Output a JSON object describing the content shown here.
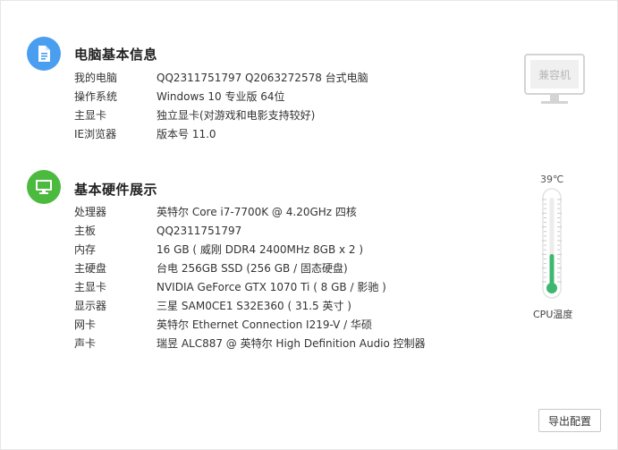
{
  "basic_info": {
    "title": "电脑基本信息",
    "rows": [
      {
        "label": "我的电脑",
        "value": "QQ2311751797 Q2063272578 台式电脑"
      },
      {
        "label": "操作系统",
        "value": "Windows 10 专业版 64位"
      },
      {
        "label": "主显卡",
        "value": "独立显卡(对游戏和电影支持较好)"
      },
      {
        "label": "IE浏览器",
        "value": "版本号 11.0"
      }
    ]
  },
  "hardware": {
    "title": "基本硬件展示",
    "rows": [
      {
        "label": "处理器",
        "value": "英特尔 Core i7-7700K @ 4.20GHz 四核"
      },
      {
        "label": "主板",
        "value": "QQ2311751797"
      },
      {
        "label": "内存",
        "value": "16 GB ( 威刚 DDR4 2400MHz 8GB x 2 )"
      },
      {
        "label": "主硬盘",
        "value": "台电 256GB SSD (256 GB / 固态硬盘)"
      },
      {
        "label": "主显卡",
        "value": "NVIDIA GeForce GTX 1070 Ti ( 8 GB / 影驰 )"
      },
      {
        "label": "显示器",
        "value": "三星 SAM0CE1 S32E360 ( 31.5 英寸 )"
      },
      {
        "label": "网卡",
        "value": "英特尔 Ethernet Connection  I219-V / 华硕"
      },
      {
        "label": "声卡",
        "value": "瑞昱 ALC887 @ 英特尔 High Definition Audio 控制器"
      }
    ]
  },
  "compat_badge": {
    "label": "兼容机",
    "icon": "monitor-icon"
  },
  "cpu_temp": {
    "value": "39℃",
    "label": "CPU温度",
    "level_fraction": 0.37,
    "color": "#3db86f"
  },
  "export_button": {
    "label": "导出配置"
  },
  "colors": {
    "basic_icon": "#4a9ef0",
    "hardware_icon": "#4cba3f"
  }
}
